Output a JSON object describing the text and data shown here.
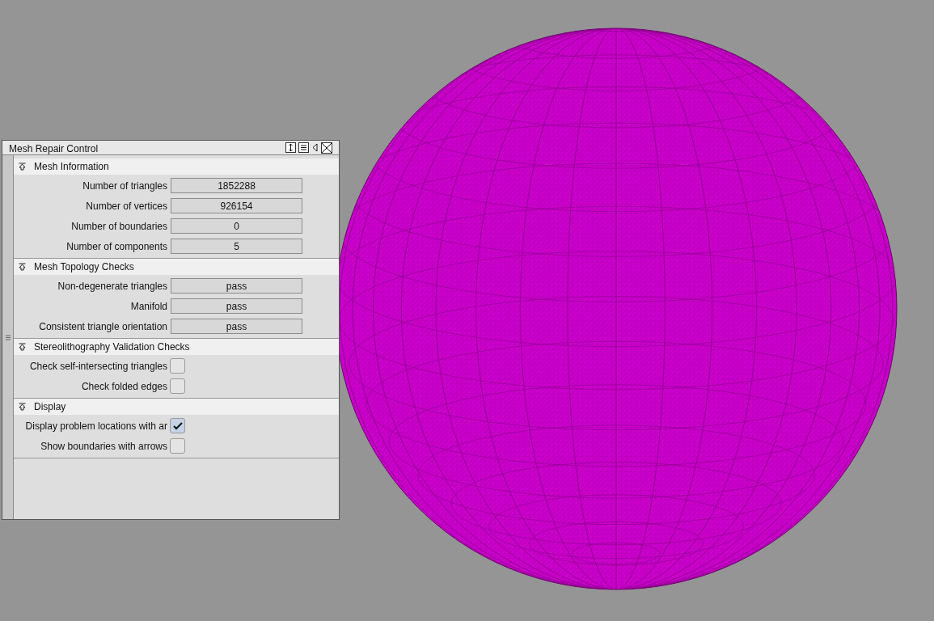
{
  "panel": {
    "title": "Mesh Repair Control"
  },
  "sections": [
    {
      "title": "Mesh Information",
      "expanded": true,
      "rows": [
        {
          "kind": "field",
          "label": "Number of triangles",
          "value": "1852288"
        },
        {
          "kind": "field",
          "label": "Number of vertices",
          "value": "926154"
        },
        {
          "kind": "field",
          "label": "Number of boundaries",
          "value": "0"
        },
        {
          "kind": "field",
          "label": "Number of components",
          "value": "5"
        }
      ]
    },
    {
      "title": "Mesh Topology Checks",
      "expanded": true,
      "rows": [
        {
          "kind": "field",
          "label": "Non-degenerate triangles",
          "value": "pass"
        },
        {
          "kind": "field",
          "label": "Manifold",
          "value": "pass"
        },
        {
          "kind": "field",
          "label": "Consistent triangle orientation",
          "value": "pass"
        }
      ]
    },
    {
      "title": "Stereolithography Validation Checks",
      "expanded": true,
      "rows": [
        {
          "kind": "check",
          "label": "Check self-intersecting triangles",
          "checked": false
        },
        {
          "kind": "check",
          "label": "Check folded edges",
          "checked": false
        }
      ]
    },
    {
      "title": "Display",
      "expanded": true,
      "rows": [
        {
          "kind": "check",
          "label": "Display problem locations with ar",
          "checked": true
        },
        {
          "kind": "check",
          "label": "Show boundaries with arrows",
          "checked": false
        }
      ]
    }
  ]
}
